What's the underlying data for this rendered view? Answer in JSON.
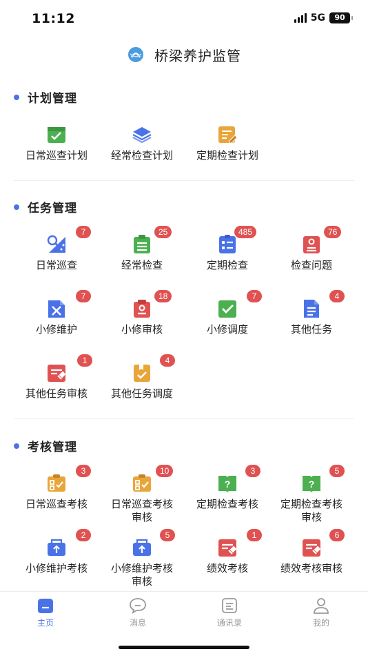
{
  "status_bar": {
    "time": "11:12",
    "network": "5G",
    "battery": "90"
  },
  "header": {
    "title": "桥梁养护监管",
    "logo_icon": "bridge-logo-icon"
  },
  "colors": {
    "accent": "#4a72e8",
    "badge": "#e05252",
    "green": "#4caf50",
    "blue": "#4a72e8",
    "red": "#e05252",
    "orange": "#e8a63a"
  },
  "plan": {
    "title": "计划管理",
    "items": [
      {
        "label": "日常巡查计划",
        "icon": "calendar-check-icon"
      },
      {
        "label": "经常检查计划",
        "icon": "layers-icon"
      },
      {
        "label": "定期检查计划",
        "icon": "edit-calendar-icon"
      }
    ]
  },
  "task": {
    "title": "任务管理",
    "items": [
      {
        "label": "日常巡查",
        "badge": "7",
        "icon": "patrol-icon"
      },
      {
        "label": "经常检查",
        "badge": "25",
        "icon": "clipboard-list-icon"
      },
      {
        "label": "定期检查",
        "badge": "485",
        "icon": "checklist-icon"
      },
      {
        "label": "检查问题",
        "badge": "76",
        "icon": "report-icon"
      },
      {
        "label": "小修维护",
        "badge": "7",
        "icon": "tools-icon"
      },
      {
        "label": "小修审核",
        "badge": "18",
        "icon": "stamp-icon"
      },
      {
        "label": "小修调度",
        "badge": "7",
        "icon": "check-icon"
      },
      {
        "label": "其他任务",
        "badge": "4",
        "icon": "document-icon"
      },
      {
        "label": "其他任务审核",
        "badge": "1",
        "icon": "gavel-icon"
      },
      {
        "label": "其他任务调度",
        "badge": "4",
        "icon": "bookmark-check-icon"
      }
    ]
  },
  "assess": {
    "title": "考核管理",
    "items": [
      {
        "label": "日常巡查考核",
        "badge": "3",
        "icon": "score-list-icon"
      },
      {
        "label": "日常巡查考核审核",
        "badge": "10",
        "icon": "score-list-icon"
      },
      {
        "label": "定期检查考核",
        "badge": "3",
        "icon": "question-book-icon"
      },
      {
        "label": "定期检查考核审核",
        "badge": "5",
        "icon": "question-book-icon"
      },
      {
        "label": "小修维护考核",
        "badge": "2",
        "icon": "upload-box-icon"
      },
      {
        "label": "小修维护考核审核",
        "badge": "5",
        "icon": "upload-box-icon"
      },
      {
        "label": "绩效考核",
        "badge": "1",
        "icon": "gavel-icon"
      },
      {
        "label": "绩效考核审核",
        "badge": "6",
        "icon": "gavel-icon"
      }
    ]
  },
  "tabs": [
    {
      "label": "主页",
      "icon": "home-icon",
      "active": true
    },
    {
      "label": "消息",
      "icon": "message-icon",
      "active": false
    },
    {
      "label": "通讯录",
      "icon": "contacts-icon",
      "active": false
    },
    {
      "label": "我的",
      "icon": "user-icon",
      "active": false
    }
  ]
}
